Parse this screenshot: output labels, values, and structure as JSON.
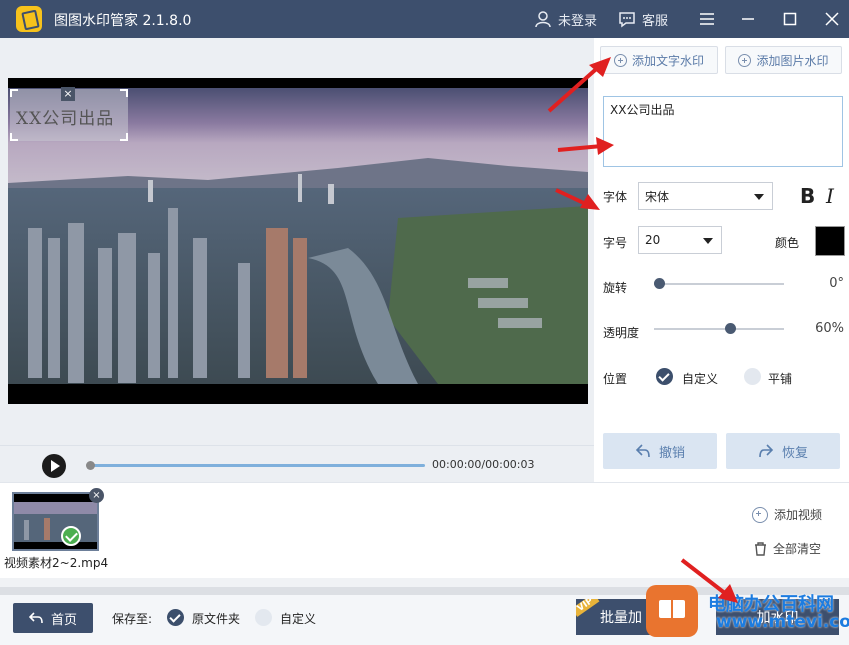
{
  "app": {
    "title": "图图水印管家  2.1.8.0"
  },
  "titlebar": {
    "user_label": "未登录",
    "service_label": "客服"
  },
  "tabs": {
    "text_watermark": "添加文字水印",
    "image_watermark": "添加图片水印"
  },
  "video": {
    "watermark_preview": "XX公司出品",
    "close_glyph": "×"
  },
  "player": {
    "time": "00:00:00/00:00:03"
  },
  "settings": {
    "text_value": "XX公司出品",
    "font_label": "字体",
    "font_value": "宋体",
    "bold_label": "B",
    "italic_label": "I",
    "size_label": "字号",
    "size_value": "20",
    "color_label": "颜色",
    "color_value": "#000000",
    "rotation_label": "旋转",
    "rotation_value": "0°",
    "rotation_fraction": 0.0,
    "opacity_label": "透明度",
    "opacity_value": "60%",
    "opacity_fraction": 0.6,
    "position_label": "位置",
    "position_options": [
      "自定义",
      "平铺"
    ],
    "position_selected": "自定义",
    "undo_label": "撤销",
    "redo_label": "恢复"
  },
  "files": {
    "items": [
      {
        "name": "视频素材2~2.mp4"
      }
    ],
    "add_video_label": "添加视频",
    "clear_all_label": "全部清空"
  },
  "bottom": {
    "home_label": "首页",
    "save_to_label": "保存至:",
    "save_options": [
      "原文件夹",
      "自定义"
    ],
    "save_selected": "原文件夹",
    "batch_label": "批量加",
    "vip_badge": "VIP",
    "add_watermark_label": "加水印"
  },
  "overlay": {
    "brand": "电脑办公百科网",
    "url": "www.mtevi.com"
  },
  "colors": {
    "titlebar": "#3d4f6d",
    "accent": "#5b7ba8",
    "arrow": "#e02020",
    "site_brand": "#1c7ce0"
  },
  "icons": [
    "app-logo-icon",
    "user-icon",
    "chat-icon",
    "menu-icon",
    "minimize-icon",
    "maximize-icon",
    "close-icon",
    "circle-plus-icon",
    "caret-down-icon",
    "undo-icon",
    "redo-icon",
    "play-icon",
    "check-icon",
    "trash-icon",
    "back-arrow-icon"
  ]
}
